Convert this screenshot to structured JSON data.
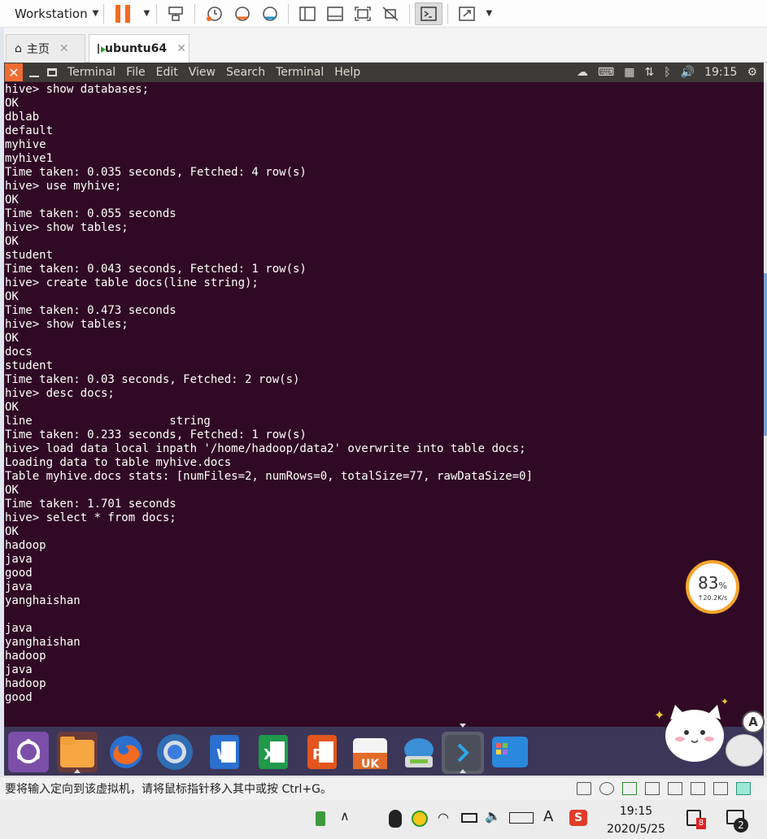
{
  "vm_toolbar": {
    "product_label": "Workstation"
  },
  "tabs": [
    {
      "label": "主页"
    },
    {
      "label": "ubuntu64"
    }
  ],
  "ubuntu_bar": {
    "menus": [
      "Terminal",
      "File",
      "Edit",
      "View",
      "Search",
      "Terminal",
      "Help"
    ],
    "time": "19:15"
  },
  "terminal": {
    "lines": [
      "hive> show databases;",
      "OK",
      "dblab",
      "default",
      "myhive",
      "myhive1",
      "Time taken: 0.035 seconds, Fetched: 4 row(s)",
      "hive> use myhive;",
      "OK",
      "Time taken: 0.055 seconds",
      "hive> show tables;",
      "OK",
      "student",
      "Time taken: 0.043 seconds, Fetched: 1 row(s)",
      "hive> create table docs(line string);",
      "OK",
      "Time taken: 0.473 seconds",
      "hive> show tables;",
      "OK",
      "docs",
      "student",
      "Time taken: 0.03 seconds, Fetched: 2 row(s)",
      "hive> desc docs;",
      "OK",
      "line                    string",
      "Time taken: 0.233 seconds, Fetched: 1 row(s)",
      "hive> load data local inpath '/home/hadoop/data2' overwrite into table docs;",
      "Loading data to table myhive.docs",
      "Table myhive.docs stats: [numFiles=2, numRows=0, totalSize=77, rawDataSize=0]",
      "OK",
      "Time taken: 1.701 seconds",
      "hive> select * from docs;",
      "OK",
      "hadoop",
      "java",
      "good",
      "java",
      "yanghaishan",
      "",
      "java",
      "yanghaishan",
      "hadoop",
      "java",
      "hadoop",
      "good"
    ]
  },
  "speed_widget": {
    "percent": "83",
    "percent_unit": "%",
    "rate": "↑20.2K/s"
  },
  "vm_status": {
    "message": "要将输入定向到该虚拟机，请将鼠标指针移入其中或按 Ctrl+G。"
  },
  "taskbar": {
    "time": "19:15",
    "date": "2020/5/25",
    "ime": "A",
    "mail_badge": "8",
    "notify_count": "2"
  },
  "colors": {
    "terminal_bg": "#300a24",
    "ubuntu_bar": "#3c3b37",
    "launcher_bg": "#3c3658",
    "accent_orange": "#f26a21"
  }
}
